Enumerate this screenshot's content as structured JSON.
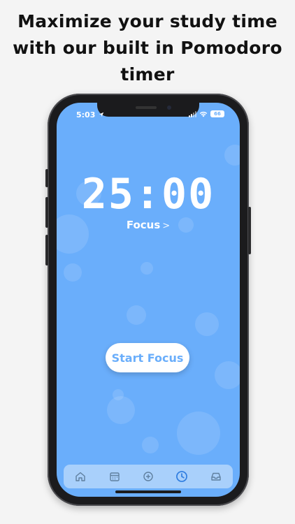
{
  "headline": {
    "line1": "Maximize your study time",
    "line2": "with our built in Pomodoro",
    "line3": "timer"
  },
  "status_bar": {
    "time": "5:03",
    "battery": "66"
  },
  "timer": {
    "display": "25:00",
    "mode_label": "Focus",
    "mode_chevron": ">"
  },
  "actions": {
    "start_label": "Start Focus"
  },
  "tab_bar": {
    "tabs": [
      {
        "icon": "home-icon",
        "active": false
      },
      {
        "icon": "calendar-icon",
        "active": false
      },
      {
        "icon": "add-circle-icon",
        "active": false
      },
      {
        "icon": "clock-icon",
        "active": true
      },
      {
        "icon": "inbox-icon",
        "active": false
      }
    ]
  },
  "colors": {
    "screen_bg": "#6aaefb",
    "tab_bar_bg": "#a9d0fb",
    "icon_inactive": "#5f7f9e",
    "icon_active": "#2f7de0",
    "button_text": "#6aaefb"
  }
}
